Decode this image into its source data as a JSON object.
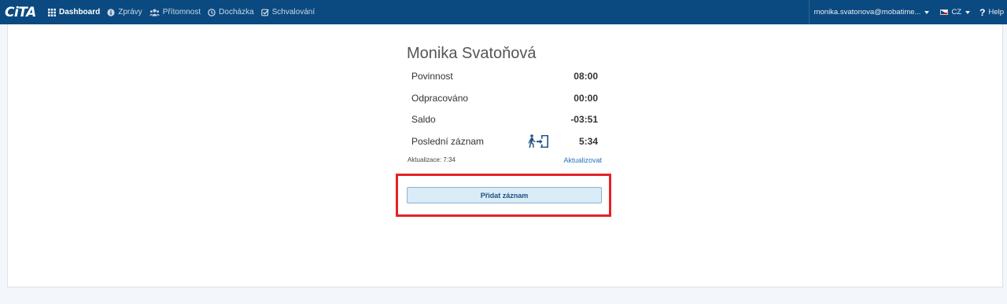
{
  "app": {
    "logo_text": "CiTA"
  },
  "nav": {
    "items": [
      {
        "label": "Dashboard",
        "icon": "grid-icon"
      },
      {
        "label": "Zprávy",
        "icon": "info-icon"
      },
      {
        "label": "Přítomnost",
        "icon": "users-icon"
      },
      {
        "label": "Docházka",
        "icon": "clock-icon"
      },
      {
        "label": "Schvalování",
        "icon": "check-square-icon"
      }
    ]
  },
  "user_menu": {
    "email": "monika.svatonova@mobatime...",
    "language": "CZ",
    "help": "Help"
  },
  "card": {
    "name": "Monika Svatoňová",
    "rows": [
      {
        "label": "Povinnost",
        "value": "08:00"
      },
      {
        "label": "Odpracováno",
        "value": "00:00"
      },
      {
        "label": "Saldo",
        "value": "-03:51"
      },
      {
        "label": "Poslední záznam",
        "value": "5:34",
        "icon": "exit-door-icon"
      }
    ],
    "update_text": "Aktualizace: 7:34",
    "update_link": "Aktualizovat",
    "add_button": "Přidat záznam"
  },
  "colors": {
    "topbar": "#0b4a80",
    "highlight": "#e52226",
    "button_bg": "#d9ecf8",
    "link": "#2a73b8"
  }
}
